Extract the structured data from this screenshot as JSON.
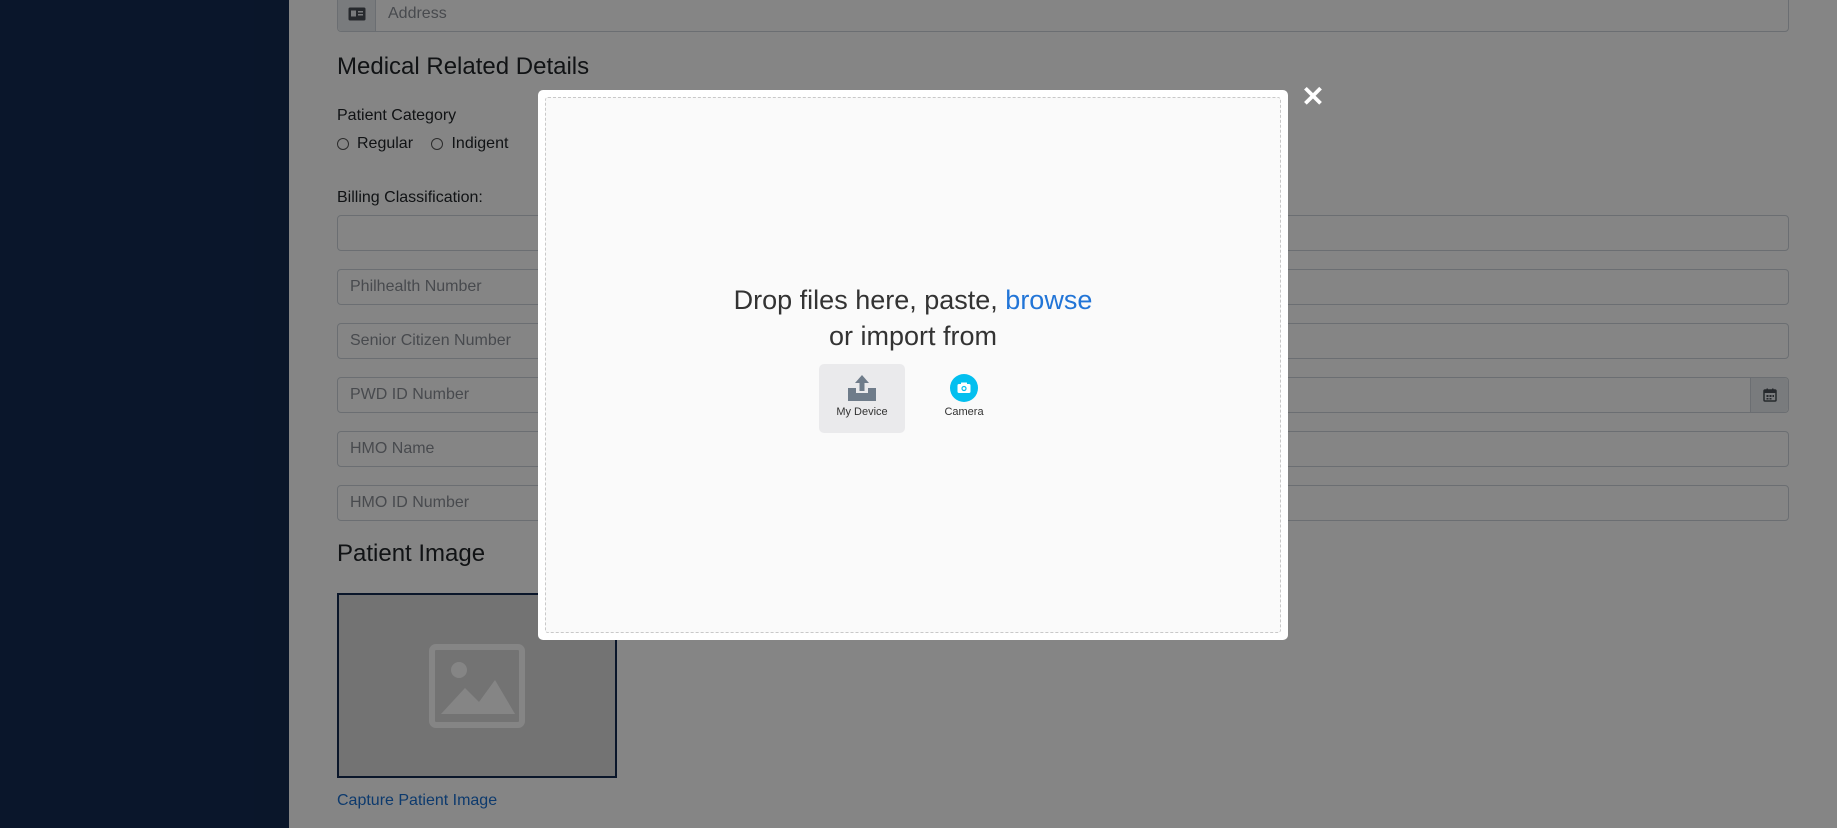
{
  "form": {
    "address_placeholder": "Address",
    "medical_heading": "Medical Related Details",
    "patient_category_label": "Patient Category",
    "category_options": [
      "Regular",
      "Indigent"
    ],
    "billing_label": "Billing Classification:",
    "philhealth_placeholder": "Philhealth Number",
    "senior_placeholder": "Senior Citizen Number",
    "pwd_placeholder": "PWD ID Number",
    "hmo_name_placeholder": "HMO Name",
    "hmo_id_placeholder": "HMO ID Number",
    "patient_image_heading": "Patient Image",
    "capture_link": "Capture Patient Image"
  },
  "upload_modal": {
    "drop_text_before": "Drop files here, paste, ",
    "browse_label": "browse",
    "drop_text_after": " or import from",
    "sources": [
      {
        "label": "My Device",
        "icon": "my-device-icon"
      },
      {
        "label": "Camera",
        "icon": "camera-icon"
      }
    ],
    "close_label": "✕"
  },
  "colors": {
    "sidebar": "#142b52",
    "browse": "#2275d7",
    "camera_accent": "#03bfef",
    "link": "#1a6fd1"
  }
}
